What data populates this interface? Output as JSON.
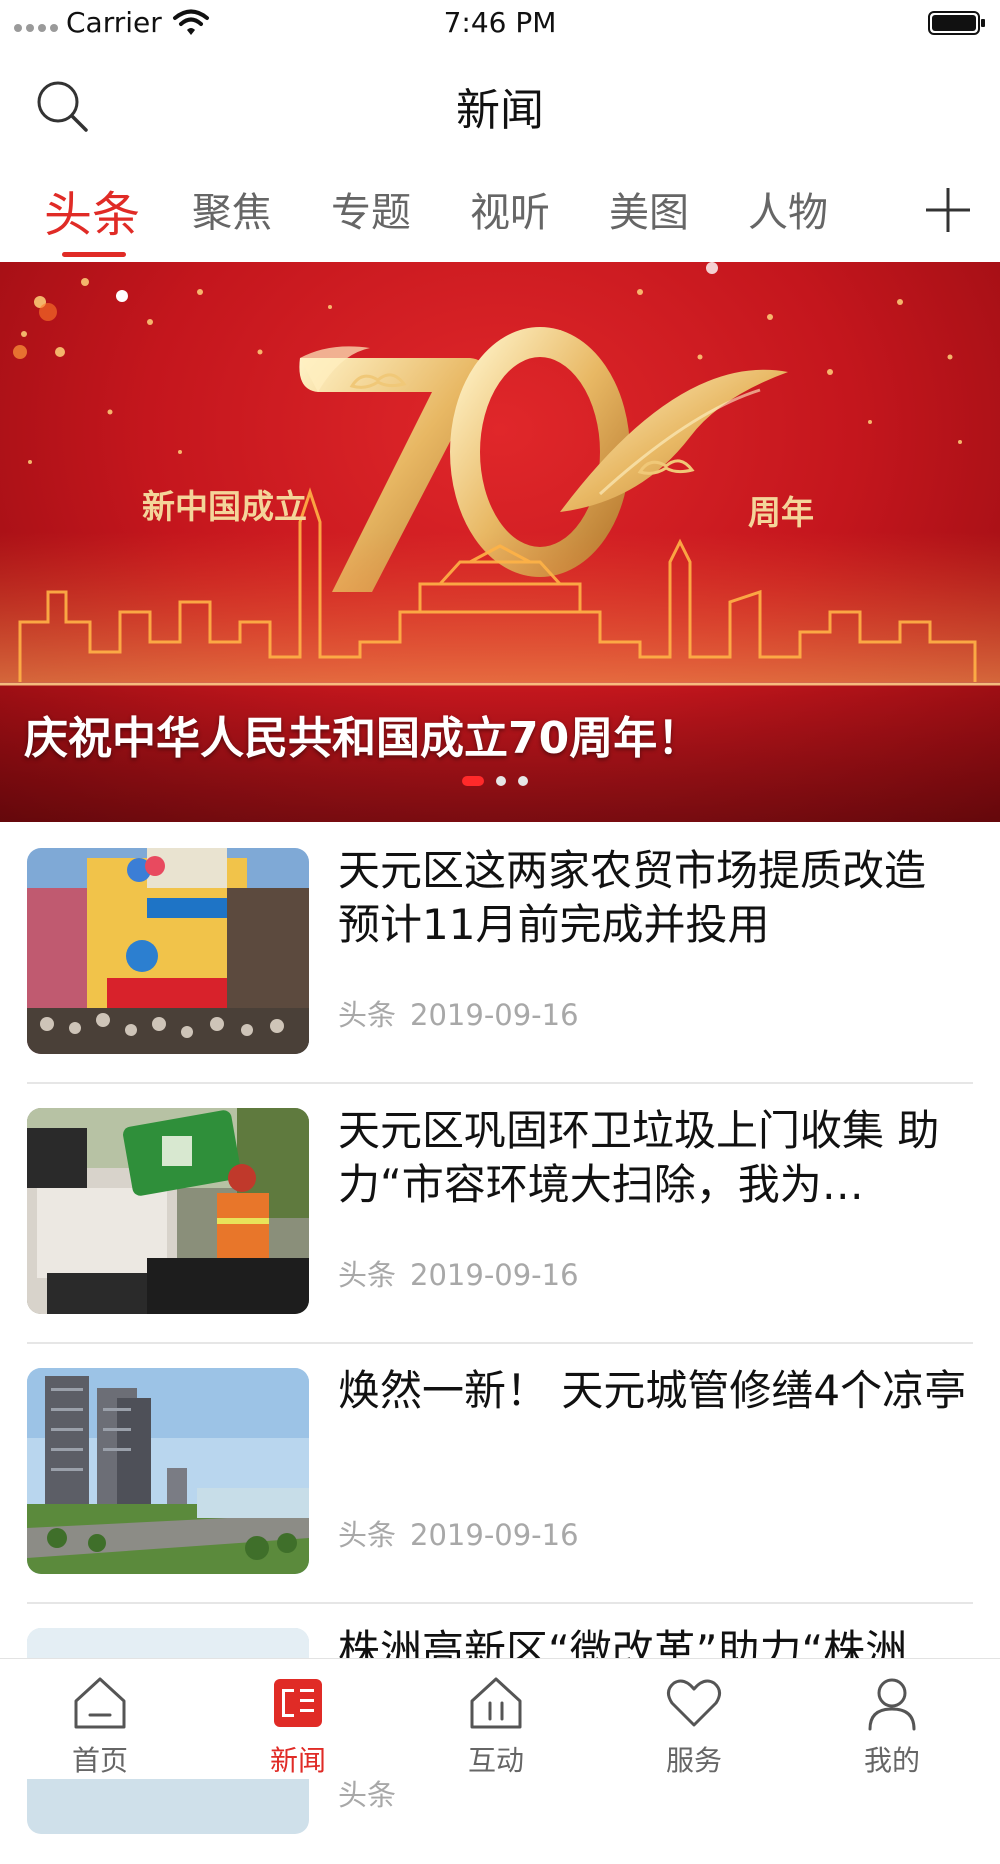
{
  "status_bar": {
    "carrier": "Carrier",
    "time": "7:46 PM"
  },
  "header": {
    "title": "新闻",
    "search_icon": "search-icon"
  },
  "tabs": {
    "items": [
      {
        "label": "头条",
        "active": true
      },
      {
        "label": "聚焦",
        "active": false
      },
      {
        "label": "专题",
        "active": false
      },
      {
        "label": "视听",
        "active": false
      },
      {
        "label": "美图",
        "active": false
      },
      {
        "label": "人物",
        "active": false
      }
    ],
    "add_icon": "plus-icon",
    "accent_color": "#e02b26"
  },
  "banner": {
    "sub_left": "新中国成立",
    "sub_right": "周年",
    "caption": "庆祝中华人民共和国成立70周年！",
    "slide_count": 3,
    "active_slide": 1
  },
  "news": [
    {
      "title": "天元区这两家农贸市场提质改造 预计11月前完成并投用",
      "category": "头条",
      "date": "2019-09-16"
    },
    {
      "title": "天元区巩固环卫垃圾上门收集 助力“市容环境大扫除，我为…",
      "category": "头条",
      "date": "2019-09-16"
    },
    {
      "title": "焕然一新！ 天元城管修缮4个凉亭",
      "category": "头条",
      "date": "2019-09-16"
    },
    {
      "title": "株洲高新区“微改革”助力“株洲",
      "category": "头条",
      "date": ""
    }
  ],
  "tabbar": {
    "items": [
      {
        "label": "首页",
        "icon": "home-icon",
        "active": false
      },
      {
        "label": "新闻",
        "icon": "news-icon",
        "active": true
      },
      {
        "label": "互动",
        "icon": "interaction-icon",
        "active": false
      },
      {
        "label": "服务",
        "icon": "heart-icon",
        "active": false
      },
      {
        "label": "我的",
        "icon": "user-icon",
        "active": false
      }
    ],
    "active_color": "#e02b26",
    "inactive_color": "#666666"
  }
}
